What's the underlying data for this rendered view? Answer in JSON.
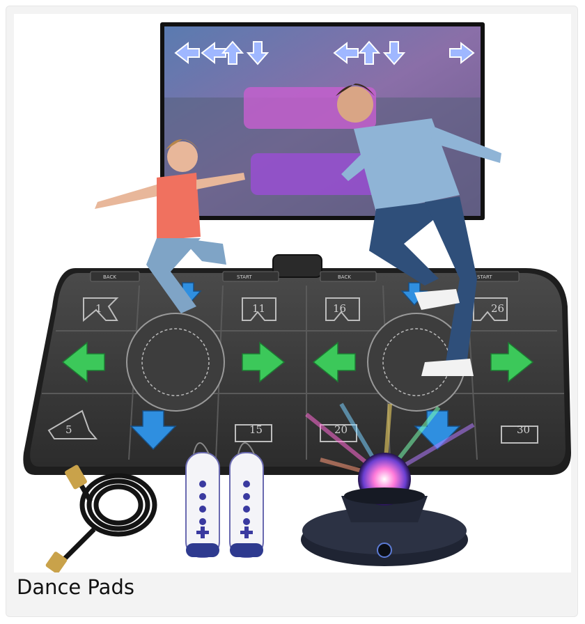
{
  "product": {
    "title": "Dance Pads"
  },
  "image": {
    "pad_numbers": [
      "1",
      "11",
      "16",
      "26",
      "5",
      "15",
      "20",
      "30"
    ],
    "pad_labels": [
      "BACK",
      "START",
      "BACK",
      "START"
    ],
    "colors": {
      "card_bg": "#f3f3f3",
      "pad_dark": "#3b3b3b",
      "arrow_green": "#3cc85a",
      "arrow_blue": "#2f8fe0",
      "screen_frame": "#1a1a1a"
    }
  }
}
